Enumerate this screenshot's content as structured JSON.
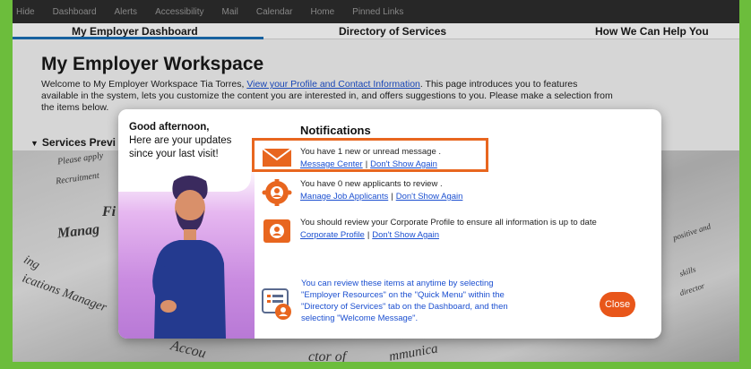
{
  "topbar": {
    "items": [
      "Hide",
      "Dashboard",
      "Alerts",
      "Accessibility",
      "Mail",
      "Calendar",
      "Home",
      "Pinned Links"
    ]
  },
  "nav": {
    "tabs": [
      "My Employer Dashboard",
      "Directory of Services",
      "How We Can Help You"
    ]
  },
  "page": {
    "title": "My Employer Workspace",
    "intro_before": "Welcome to My Employer Workspace Tia Torres,",
    "intro_link": "View your Profile and Contact Information",
    "intro_after": ". This page introduces you to features available in the system, lets you customize the content you are interested in, and offers suggestions to you. Please make a selection from the items below.",
    "services_label": "Services Previ"
  },
  "background_words": [
    "Please apply",
    "Recruitment",
    "Fi",
    "Manag",
    "ing",
    "ications Manager",
    "Accou",
    "ctor of",
    "mmunica",
    "positive and",
    "skills",
    "director"
  ],
  "modal": {
    "greeting": "Good afternoon,",
    "greeting_sub": "Here are your updates since your last visit!",
    "title": "Notifications",
    "notifications": [
      {
        "icon": "envelope-icon",
        "message": "You have 1 new or unread message .",
        "link1": "Message Center",
        "link2": "Don't Show Again"
      },
      {
        "icon": "applicants-icon",
        "message": "You have 0 new applicants to review .",
        "link1": "Manage Job Applicants",
        "link2": "Don't Show Again"
      },
      {
        "icon": "profile-icon",
        "message": "You should review your Corporate Profile to ensure all information is up to date",
        "link1": "Corporate Profile",
        "link2": "Don't Show Again"
      }
    ],
    "footer": "You can review these items at anytime by selecting \"Employer Resources\" on the \"Quick Menu\" within the \"Directory of Services\" tab on the Dashboard, and then selecting \"Welcome Message\".",
    "close_label": "Close",
    "separator": "|"
  },
  "colors": {
    "accent_orange": "#e8661f",
    "link_blue": "#1b4fd0",
    "border_green": "#6cbd3c"
  }
}
